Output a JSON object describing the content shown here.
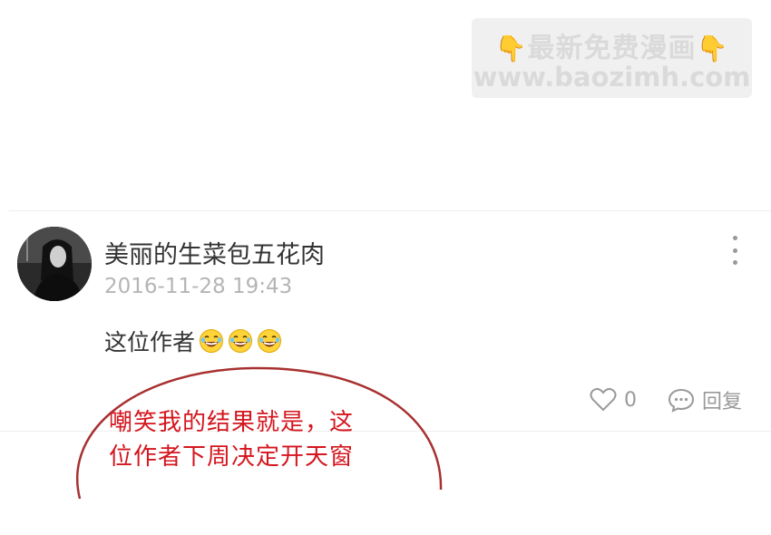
{
  "watermark": {
    "title": "最新免费漫画",
    "url": "www.baozimh.com"
  },
  "comment": {
    "username": "美丽的生菜包五花肉",
    "timestamp": "2016-11-28 19:43",
    "text": "这位作者",
    "emoji_icons": [
      "laughing-tears-icon",
      "laughing-tears-icon",
      "laughing-tears-icon"
    ],
    "like_count": "0",
    "reply_label": "回复"
  },
  "annotation": {
    "line1": "嘲笑我的结果就是，这",
    "line2": "位作者下周决定开天窗",
    "color": "#d4161e"
  }
}
